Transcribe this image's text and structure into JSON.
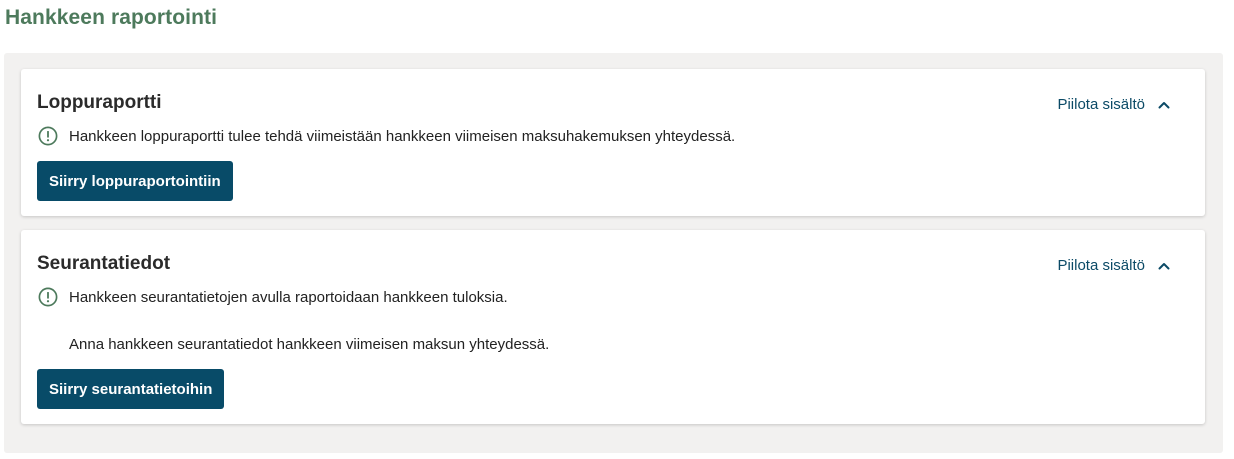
{
  "page": {
    "title": "Hankkeen raportointi"
  },
  "sections": [
    {
      "title": "Loppuraportti",
      "toggle_label": "Piilota sisältö",
      "toggle_icon": "chevron-up-icon",
      "info_icon": "exclamation-circle-icon",
      "info_text": "Hankkeen loppuraportti tulee tehdä viimeistään hankkeen viimeisen maksuhakemuksen yhteydessä.",
      "button_label": "Siirry loppuraportointiin"
    },
    {
      "title": "Seurantatiedot",
      "toggle_label": "Piilota sisältö",
      "toggle_icon": "chevron-up-icon",
      "info_icon": "exclamation-circle-icon",
      "info_text": "Hankkeen seurantatietojen avulla raportoidaan hankkeen tuloksia.",
      "extra_text": "Anna hankkeen seurantatiedot hankkeen viimeisen maksun yhteydessä.",
      "button_label": "Siirry seurantatietoihin"
    }
  ],
  "colors": {
    "title_green": "#4d7a5c",
    "primary_blue": "#084b68",
    "link_blue": "#0b4a66",
    "panel_bg": "#f2f1f0",
    "icon_green": "#4d7a5c"
  }
}
